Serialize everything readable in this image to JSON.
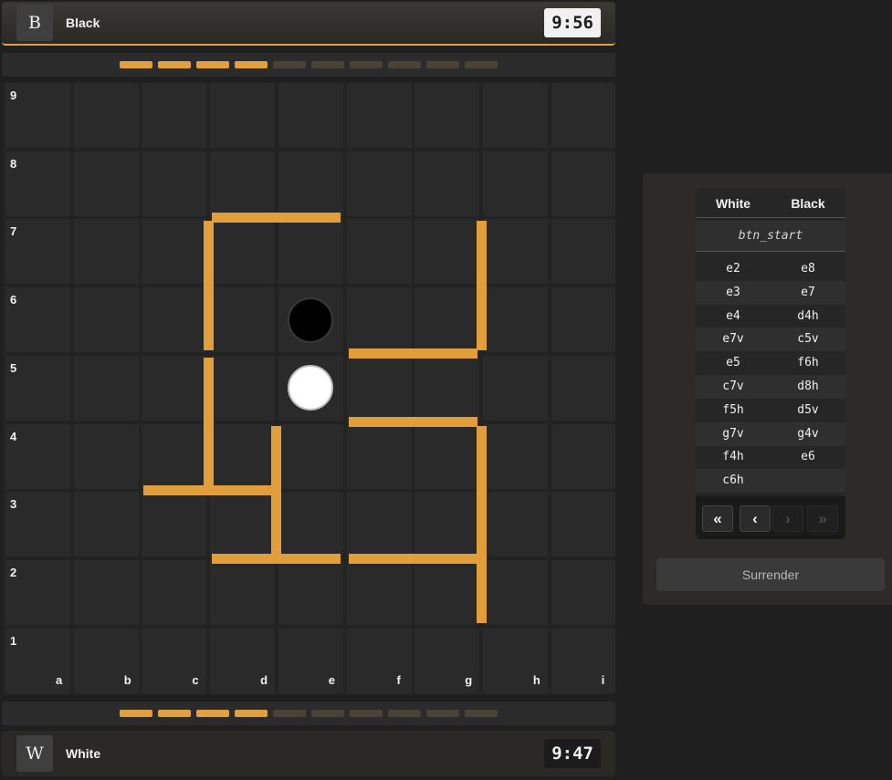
{
  "black_player": {
    "avatar_letter": "B",
    "name": "Black",
    "clock": "9:56",
    "walls_remaining": 4,
    "walls_total": 10
  },
  "white_player": {
    "avatar_letter": "W",
    "name": "White",
    "clock": "9:47",
    "walls_remaining": 4,
    "walls_total": 10
  },
  "board": {
    "files": [
      "a",
      "b",
      "c",
      "d",
      "e",
      "f",
      "g",
      "h",
      "i"
    ],
    "ranks": [
      "9",
      "8",
      "7",
      "6",
      "5",
      "4",
      "3",
      "2",
      "1"
    ],
    "pawns": [
      {
        "color": "black",
        "square": "e6"
      },
      {
        "color": "white",
        "square": "e5"
      }
    ],
    "walls": [
      "c7v",
      "d8h",
      "c5v",
      "f6h",
      "c4h",
      "d4v",
      "d3h",
      "f5h",
      "g4v",
      "g7v",
      "f3h",
      "g3v"
    ]
  },
  "move_list": {
    "headers": {
      "white": "White",
      "black": "Black"
    },
    "start_label": "btn_start",
    "moves": [
      {
        "white": "e2",
        "black": "e8"
      },
      {
        "white": "e3",
        "black": "e7"
      },
      {
        "white": "e4",
        "black": "d4h"
      },
      {
        "white": "e7v",
        "black": "c5v"
      },
      {
        "white": "e5",
        "black": "f6h"
      },
      {
        "white": "c7v",
        "black": "d8h"
      },
      {
        "white": "f5h",
        "black": "d5v"
      },
      {
        "white": "g7v",
        "black": "g4v"
      },
      {
        "white": "f4h",
        "black": "e6"
      },
      {
        "white": "c6h",
        "black": ""
      }
    ]
  },
  "nav": {
    "first": "«",
    "prev": "‹",
    "next": "›",
    "last": "»"
  },
  "surrender_label": "Surrender",
  "colors": {
    "accent": "#e39e3c",
    "background": "#1f1f1f"
  }
}
